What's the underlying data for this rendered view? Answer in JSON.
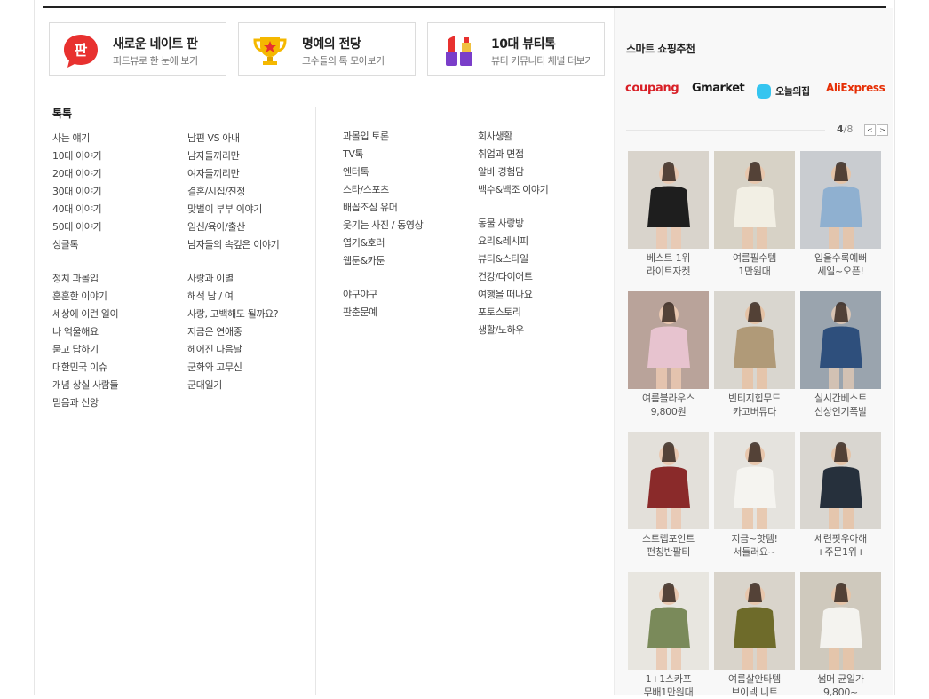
{
  "promos": [
    {
      "title": "새로운 네이트 판",
      "sub": "피드뷰로 한 눈에 보기",
      "icon": "pan-icon",
      "icon_text": "판"
    },
    {
      "title": "명예의 전당",
      "sub": "고수들의 톡 모아보기",
      "icon": "trophy-icon"
    },
    {
      "title": "10대 뷰티톡",
      "sub": "뷰티 커뮤니티 채널 더보기",
      "icon": "lipstick-icon"
    }
  ],
  "section_title": "톡톡",
  "columns": [
    [
      "사는 얘기",
      "10대 이야기",
      "20대 이야기",
      "30대 이야기",
      "40대 이야기",
      "50대 이야기",
      "싱글톡",
      "",
      "정치 과몰입",
      "훈훈한 이야기",
      "세상에 이런 일이",
      "나 억울해요",
      "묻고 답하기",
      "대한민국 이슈",
      "개념 상실 사람들",
      "믿음과 신앙"
    ],
    [
      "남편 VS 아내",
      "남자들끼리만",
      "여자들끼리만",
      "결혼/시집/친정",
      "맞벌이 부부 이야기",
      "임신/육아/출산",
      "남자들의 속깊은 이야기",
      "",
      "사랑과 이별",
      "해석 남 / 여",
      "사랑, 고백해도 될까요?",
      "지금은 연애중",
      "헤어진 다음날",
      "군화와 고무신",
      "군대일기"
    ],
    [
      "과몰입 토론",
      "TV톡",
      "엔터톡",
      "스타/스포츠",
      "배꼽조심 유머",
      "웃기는 사진 / 동영상",
      "엽기&호러",
      "웹툰&카툰",
      "",
      "야구야구",
      "판춘문예"
    ],
    [
      "회사생활",
      "취업과 면접",
      "알바 경험담",
      "백수&백조 이야기",
      "",
      "동물 사랑방",
      "요리&레시피",
      "뷰티&스타일",
      "건강/다이어트",
      "여행을 떠나요",
      "포토스토리",
      "생활/노하우"
    ]
  ],
  "shopping": {
    "title": "스마트 쇼핑추천",
    "logos": [
      "coupang",
      "Gmarket",
      "오늘의집",
      "AliExpress"
    ],
    "page_current": "4",
    "page_total": "/8",
    "prev_label": "<",
    "next_label": ">",
    "products": [
      [
        "베스트 1위",
        "라이트자켓"
      ],
      [
        "여름필수템",
        "1만원대"
      ],
      [
        "입을수록예뻐",
        "세일~오픈!"
      ],
      [
        "여름블라우스",
        "9,800원"
      ],
      [
        "빈티지힙무드",
        "카고버뮤다"
      ],
      [
        "실시간베스트",
        "신상인기폭발"
      ],
      [
        "스트랩포인트",
        "펀칭반팔티"
      ],
      [
        "지금~핫템!",
        "서둘러요~"
      ],
      [
        "세련핏우아해",
        "+주문1위+"
      ],
      [
        "1+1스카프",
        "무배1만원대"
      ],
      [
        "여름살안타템",
        "브이넥 니트"
      ],
      [
        "썸머 균일가",
        "9,800~"
      ]
    ]
  },
  "colors": {
    "accent_red": "#e8312f",
    "coupang_red": "#d81f26",
    "ohou_blue": "#35c5f0",
    "ali_orange": "#e62e04"
  }
}
